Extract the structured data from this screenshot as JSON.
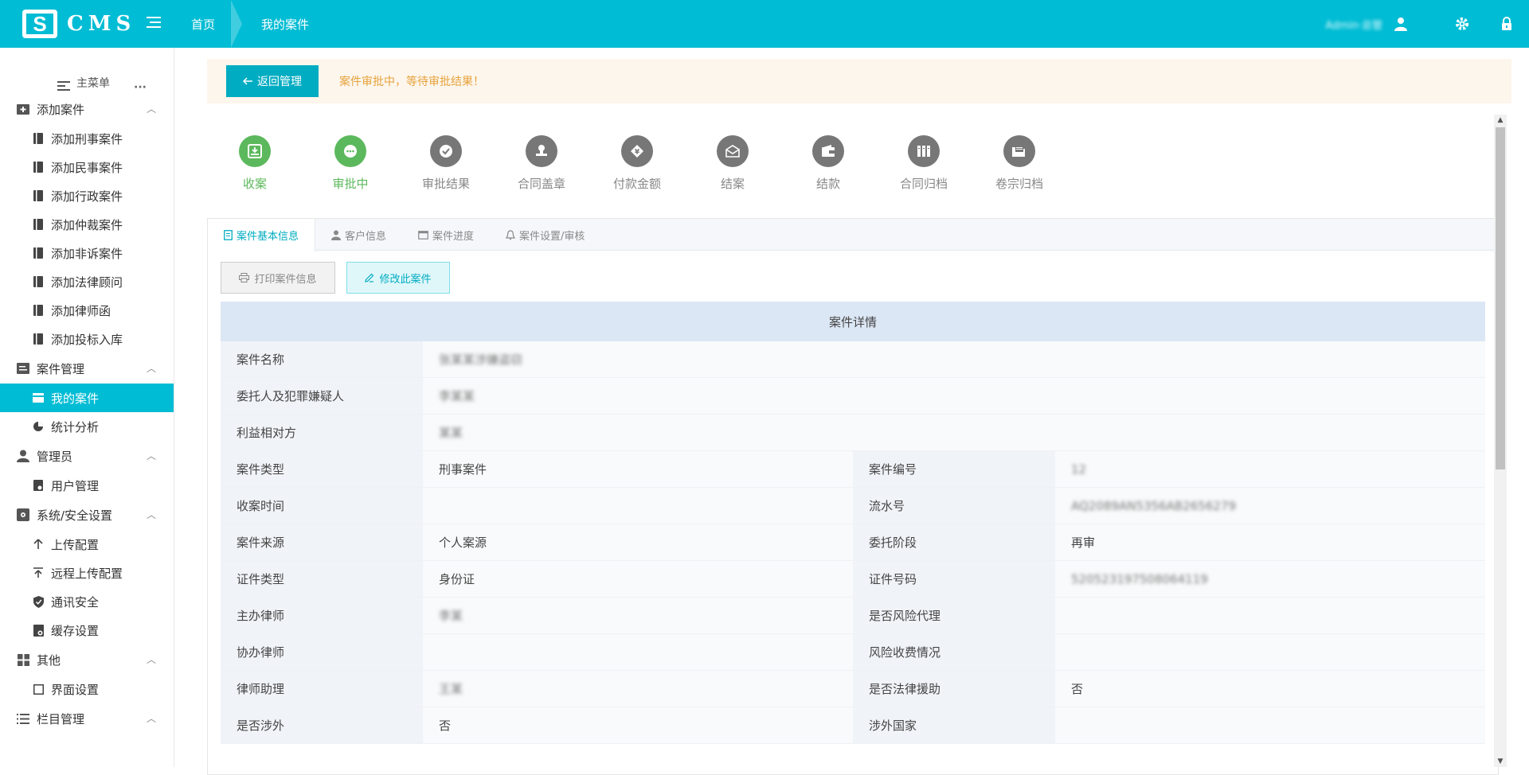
{
  "app": {
    "logo_letter": "S",
    "logo_text": "CMS"
  },
  "header": {
    "breadcrumbs": [
      "首页",
      "我的案件"
    ],
    "username": "Admin·总管"
  },
  "sidebar": {
    "title": "主菜单",
    "groups": [
      {
        "label": "添加案件",
        "items": [
          "添加刑事案件",
          "添加民事案件",
          "添加行政案件",
          "添加仲裁案件",
          "添加非诉案件",
          "添加法律顾问",
          "添加律师函",
          "添加投标入库"
        ]
      },
      {
        "label": "案件管理",
        "items": [
          "我的案件",
          "统计分析"
        ]
      },
      {
        "label": "管理员",
        "items": [
          "用户管理"
        ]
      },
      {
        "label": "系统/安全设置",
        "items": [
          "上传配置",
          "远程上传配置",
          "通讯安全",
          "缓存设置"
        ]
      },
      {
        "label": "其他",
        "items": [
          "界面设置"
        ]
      },
      {
        "label": "栏目管理",
        "items": []
      }
    ],
    "active_item": "我的案件"
  },
  "notice": {
    "back_label": "返回管理",
    "message": "案件审批中，等待审批结果！"
  },
  "steps": [
    {
      "label": "收案",
      "state": "done"
    },
    {
      "label": "审批中",
      "state": "done"
    },
    {
      "label": "审批结果",
      "state": "todo"
    },
    {
      "label": "合同盖章",
      "state": "todo"
    },
    {
      "label": "付款金额",
      "state": "todo"
    },
    {
      "label": "结案",
      "state": "todo"
    },
    {
      "label": "结款",
      "state": "todo"
    },
    {
      "label": "合同归档",
      "state": "todo"
    },
    {
      "label": "卷宗归档",
      "state": "todo"
    }
  ],
  "tabs": [
    "案件基本信息",
    "客户信息",
    "案件进度",
    "案件设置/审核"
  ],
  "actions": {
    "print_label": "打印案件信息",
    "edit_label": "修改此案件"
  },
  "details": {
    "title": "案件详情",
    "full_rows": [
      {
        "key": "案件名称",
        "value": "张某某涉嫌盗窃",
        "masked": true
      },
      {
        "key": "委托人及犯罪嫌疑人",
        "value": "李某某",
        "masked": true
      },
      {
        "key": "利益相对方",
        "value": "某某",
        "masked": true
      }
    ],
    "pair_rows": [
      {
        "k1": "案件类型",
        "v1": "刑事案件",
        "m1": false,
        "k2": "案件编号",
        "v2": "12",
        "m2": true
      },
      {
        "k1": "收案时间",
        "v1": "",
        "m1": false,
        "k2": "流水号",
        "v2": "AQ2089AN5356AB2656279",
        "m2": true
      },
      {
        "k1": "案件来源",
        "v1": "个人案源",
        "m1": false,
        "k2": "委托阶段",
        "v2": "再审",
        "m2": false
      },
      {
        "k1": "证件类型",
        "v1": "身份证",
        "m1": false,
        "k2": "证件号码",
        "v2": "520523197508064119",
        "m2": true
      },
      {
        "k1": "主办律师",
        "v1": "李某",
        "m1": true,
        "k2": "是否风险代理",
        "v2": "",
        "m2": false
      },
      {
        "k1": "协办律师",
        "v1": "",
        "m1": false,
        "k2": "风险收费情况",
        "v2": "",
        "m2": false
      },
      {
        "k1": "律师助理",
        "v1": "王某",
        "m1": true,
        "k2": "是否法律援助",
        "v2": "否",
        "m2": false
      },
      {
        "k1": "是否涉外",
        "v1": "否",
        "m1": false,
        "k2": "涉外国家",
        "v2": "",
        "m2": false
      }
    ]
  },
  "colors": {
    "primary": "#00bcd4",
    "done": "#5cb85c",
    "todo": "#777777",
    "warning": "#e6a23c"
  }
}
